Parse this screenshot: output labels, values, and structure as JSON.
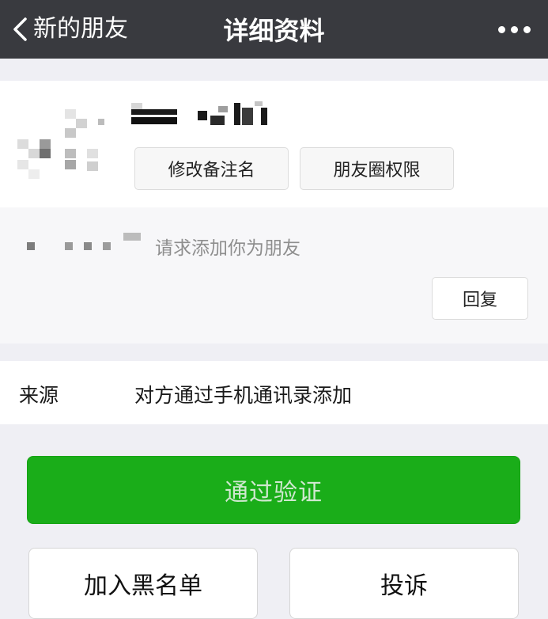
{
  "navbar": {
    "back_label": "新的朋友",
    "title": "详细资料",
    "back_icon": "chevron-left-icon",
    "more_icon": "more-horizontal-icon"
  },
  "profile": {
    "remark_button": "修改备注名",
    "moments_button": "朋友圈权限"
  },
  "request": {
    "message": "请求添加你为朋友",
    "reply_button": "回复"
  },
  "source": {
    "label": "来源",
    "value": "对方通过手机通讯录添加"
  },
  "actions": {
    "verify_button": "通过验证",
    "blacklist_button": "加入黑名单",
    "report_button": "投诉"
  },
  "colors": {
    "navbar_bg": "#393a3f",
    "page_bg": "#efeff4",
    "accept_green": "#1aad19"
  }
}
